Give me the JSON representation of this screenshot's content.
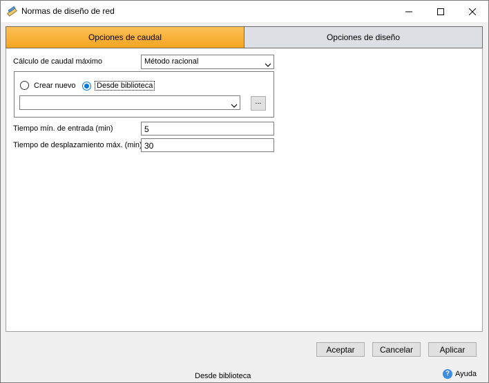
{
  "window": {
    "title": "Normas de diseño de red"
  },
  "tabs": [
    {
      "label": "Opciones de caudal",
      "active": true
    },
    {
      "label": "Opciones de diseño",
      "active": false
    }
  ],
  "form": {
    "peak_flow_label": "Cálculo de caudal máximo",
    "peak_flow_value": "Método racional",
    "radio_create_label": "Crear nuevo",
    "radio_library_label": "Desde biblioteca",
    "selected_radio": "library",
    "library_value": "",
    "browse_label": "...",
    "min_entry_time_label": "Tiempo mín. de entrada (min)",
    "min_entry_time_value": "5",
    "max_travel_time_label": "Tiempo de desplazamiento máx. (min)",
    "max_travel_time_value": "30"
  },
  "buttons": {
    "accept": "Aceptar",
    "cancel": "Cancelar",
    "apply": "Aplicar"
  },
  "status": {
    "text": "Desde biblioteca",
    "help_label": "Ayuda",
    "help_glyph": "?"
  },
  "colors": {
    "active_tab": "#f6a521",
    "inactive_tab": "#dcdfe3",
    "radio_accent": "#0078d7",
    "help_icon": "#3d8ee0"
  },
  "icons": {
    "app": "ruler-pencil-icon",
    "minimize": "minimize-icon",
    "maximize": "maximize-icon",
    "close": "close-icon",
    "dropdown": "chevron-down-icon",
    "help": "help-icon"
  }
}
